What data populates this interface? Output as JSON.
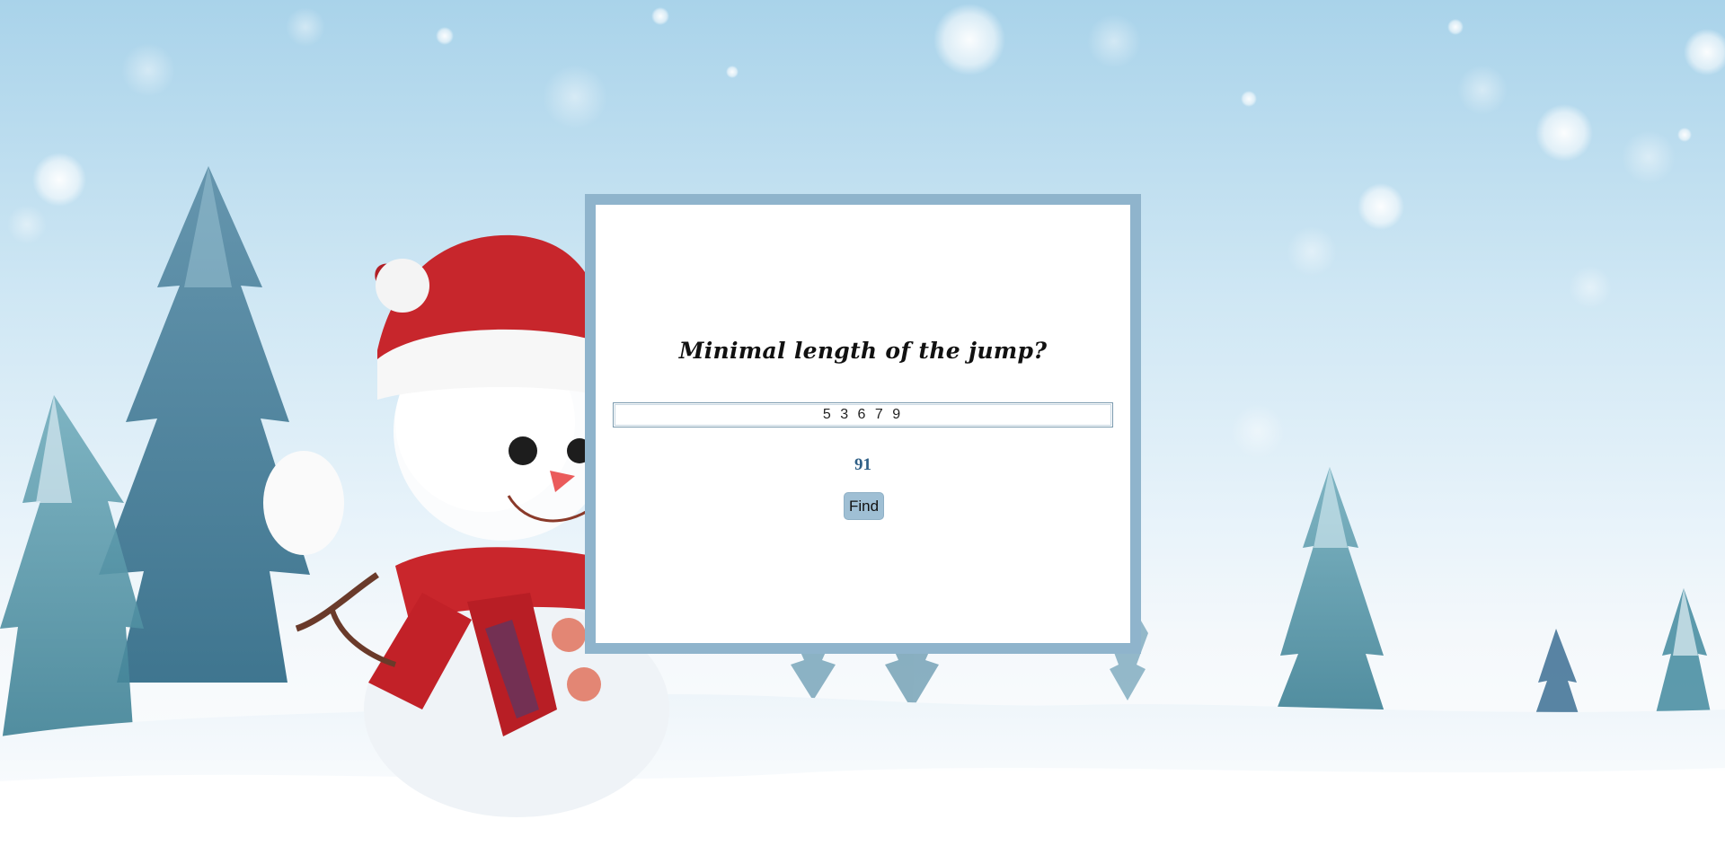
{
  "puzzle": {
    "title": "Minimal length of the jump?",
    "input_value": "5 3 6 7 9",
    "result": "91",
    "find_label": "Find"
  },
  "colors": {
    "frame": "#8fb4cc",
    "result_text": "#2f5f86",
    "button_bg": "#9fbfd4"
  },
  "background": {
    "scene": "winter snowman with pine trees in snow"
  }
}
